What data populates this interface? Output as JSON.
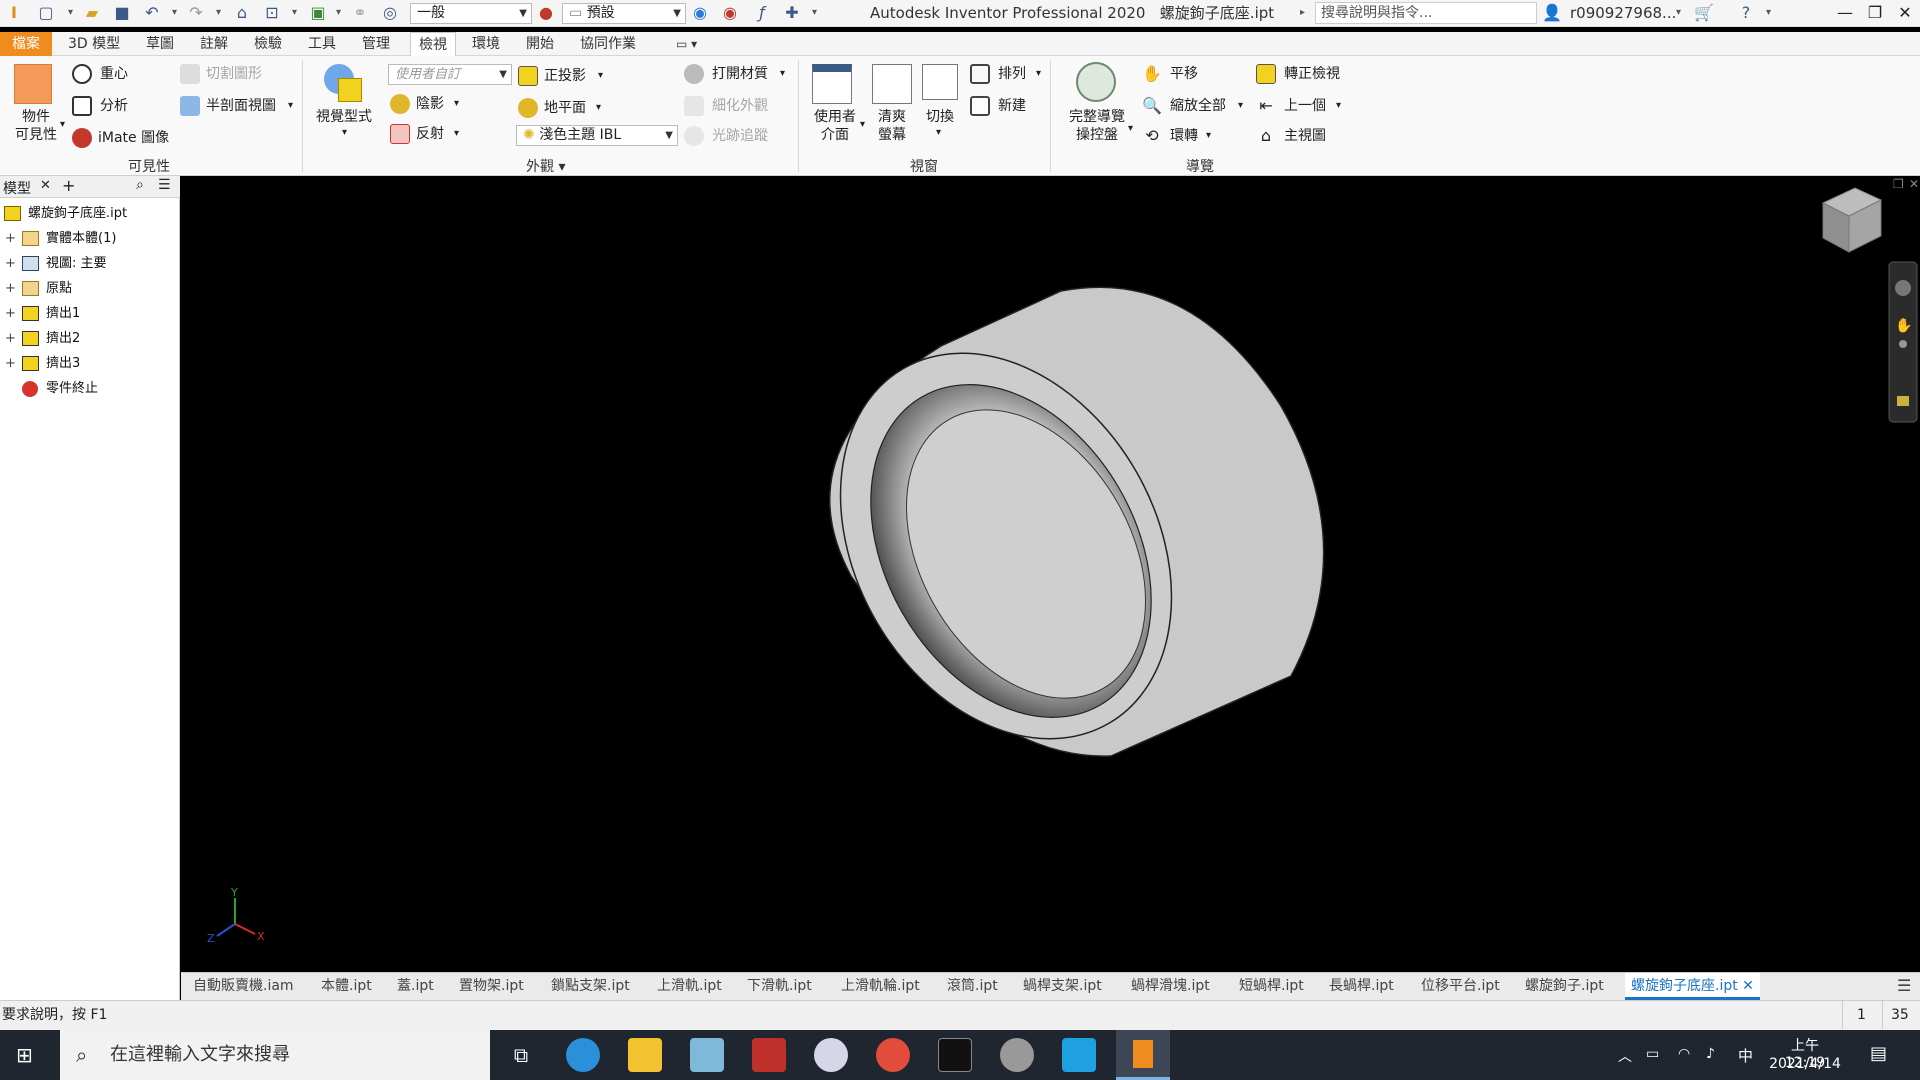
{
  "titlebar": {
    "app_title": "Autodesk Inventor Professional 2020",
    "doc_title": "螺旋鉤子底座.ipt",
    "material_combo": "一般",
    "appearance_combo": "預設",
    "help_search_placeholder": "搜尋說明與指令...",
    "user_name": "r090927968...",
    "minimize": "—",
    "restore": "❐",
    "close": "✕"
  },
  "tabs": {
    "file": "檔案",
    "items": [
      "3D 模型",
      "草圖",
      "註解",
      "檢驗",
      "工具",
      "管理",
      "檢視",
      "環境",
      "開始",
      "協同作業"
    ],
    "active": "檢視"
  },
  "ribbon": {
    "visibility": {
      "object_visibility": "物件\n可見性",
      "center_of_gravity": "重心",
      "analysis": "分析",
      "imate_glyph": "iMate 圖像",
      "half_section": "半剖面視圖",
      "quarter_section": "切割圖形",
      "group": "可見性"
    },
    "appearance": {
      "visual_style": "視覺型式",
      "user_defined": "使用者自訂",
      "shadows": "陰影",
      "reflections": "反射",
      "orthographic": "正投影",
      "ground_plane": "地平面",
      "lighting_combo": "淺色主題 IBL",
      "texture_on": "打開材質",
      "refine_appearance": "細化外觀",
      "ray_tracing": "光跡追蹤",
      "group": "外觀"
    },
    "windows": {
      "user_interface": "使用者\n介面",
      "clean_screen": "清爽\n螢幕",
      "switch": "切換",
      "arrange": "排列",
      "new": "新建",
      "group": "視窗"
    },
    "navigate": {
      "full_nav_wheel": "完整導覽\n操控盤",
      "pan": "平移",
      "zoom_all": "縮放全部",
      "orbit": "環轉",
      "look_at": "轉正檢視",
      "previous": "上一個",
      "home_view": "主視圖",
      "group": "導覽"
    }
  },
  "browser": {
    "tab_label": "模型",
    "items": [
      {
        "label": "螺旋鉤子底座.ipt",
        "icon": "part-icon",
        "expand": ""
      },
      {
        "label": "實體本體(1)",
        "icon": "folder-icon",
        "expand": "+"
      },
      {
        "label": "視圖: 主要",
        "icon": "view-icon",
        "expand": "+"
      },
      {
        "label": "原點",
        "icon": "folder-icon",
        "expand": "+"
      },
      {
        "label": "擠出1",
        "icon": "extrude-icon",
        "expand": "+"
      },
      {
        "label": "擠出2",
        "icon": "extrude-icon",
        "expand": "+"
      },
      {
        "label": "擠出3",
        "icon": "extrude-icon",
        "expand": "+"
      },
      {
        "label": "零件終止",
        "icon": "end-of-part-icon",
        "expand": ""
      }
    ]
  },
  "axis": {
    "x": "X",
    "y": "Y",
    "z": "Z"
  },
  "doc_tabs": {
    "items": [
      "自動販賣機.iam",
      "本體.ipt",
      "蓋.ipt",
      "置物架.ipt",
      "鎖點支架.ipt",
      "上滑軌.ipt",
      "下滑軌.ipt",
      "上滑軌輪.ipt",
      "滾筒.ipt",
      "蝸桿支架.ipt",
      "蝸桿滑塊.ipt",
      "短蝸桿.ipt",
      "長蝸桿.ipt",
      "位移平台.ipt",
      "螺旋鉤子.ipt"
    ],
    "active": "螺旋鉤子底座.ipt"
  },
  "status": {
    "help_text": "要求說明，按 F1",
    "count1": "1",
    "count2": "35"
  },
  "taskbar": {
    "search_placeholder": "在這裡輸入文字來搜尋",
    "time": "上午 12:19",
    "date": "2021/4/14",
    "ime": "中"
  }
}
